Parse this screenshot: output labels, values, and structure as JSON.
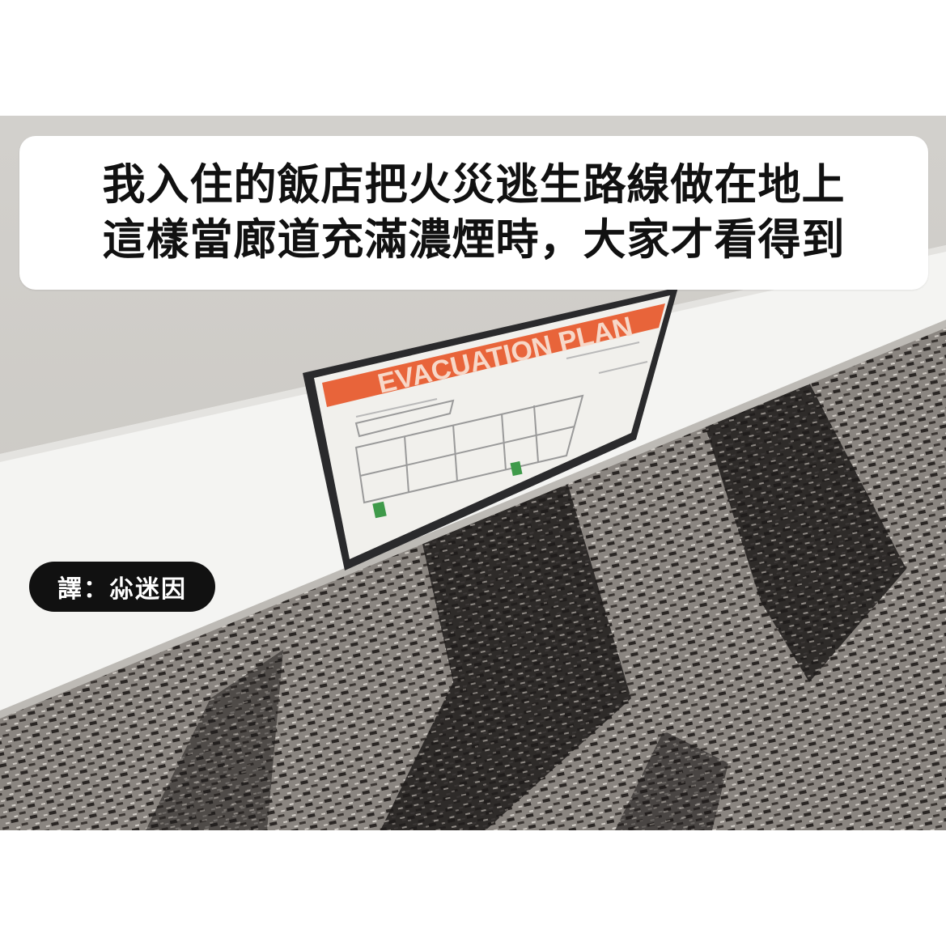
{
  "caption": {
    "line1": "我入住的飯店把火災逃生路線做在地上",
    "line2": "這樣當廊道充滿濃煙時，大家才看得到"
  },
  "credit": {
    "text": "譯：尛迷因"
  },
  "sign": {
    "title": "EVACUATION PLAN"
  },
  "colors": {
    "caption_bg": "#ffffff",
    "caption_text": "#111111",
    "credit_bg": "#111111",
    "credit_text": "#ffffff",
    "sign_banner": "#e8643a"
  }
}
